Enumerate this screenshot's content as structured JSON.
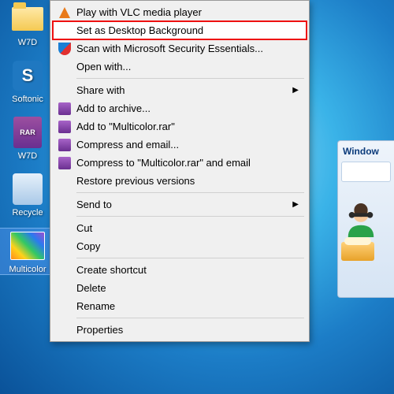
{
  "desktop": {
    "icons": [
      {
        "label": "W7D",
        "type": "folder"
      },
      {
        "label": "Softonic",
        "type": "softonic"
      },
      {
        "label": "W7D",
        "type": "rar"
      },
      {
        "label": "Recycle",
        "type": "recycle"
      },
      {
        "label": "Multicolor",
        "type": "multicolor",
        "selected": true
      }
    ]
  },
  "context_menu": {
    "items": [
      {
        "label": "Play with VLC media player",
        "icon": "vlc"
      },
      {
        "label": "Set as Desktop Background",
        "highlighted": true
      },
      {
        "label": "Scan with Microsoft Security Essentials...",
        "icon": "shield"
      },
      {
        "label": "Open with..."
      },
      {
        "sep": true
      },
      {
        "label": "Share with",
        "submenu": true
      },
      {
        "label": "Add to archive...",
        "icon": "rar"
      },
      {
        "label": "Add to \"Multicolor.rar\"",
        "icon": "rar"
      },
      {
        "label": "Compress and email...",
        "icon": "rar"
      },
      {
        "label": "Compress to \"Multicolor.rar\" and email",
        "icon": "rar"
      },
      {
        "label": "Restore previous versions"
      },
      {
        "sep": true
      },
      {
        "label": "Send to",
        "submenu": true
      },
      {
        "sep": true
      },
      {
        "label": "Cut"
      },
      {
        "label": "Copy"
      },
      {
        "sep": true
      },
      {
        "label": "Create shortcut"
      },
      {
        "label": "Delete"
      },
      {
        "label": "Rename"
      },
      {
        "sep": true
      },
      {
        "label": "Properties"
      }
    ]
  },
  "side_panel": {
    "title": "Window"
  }
}
